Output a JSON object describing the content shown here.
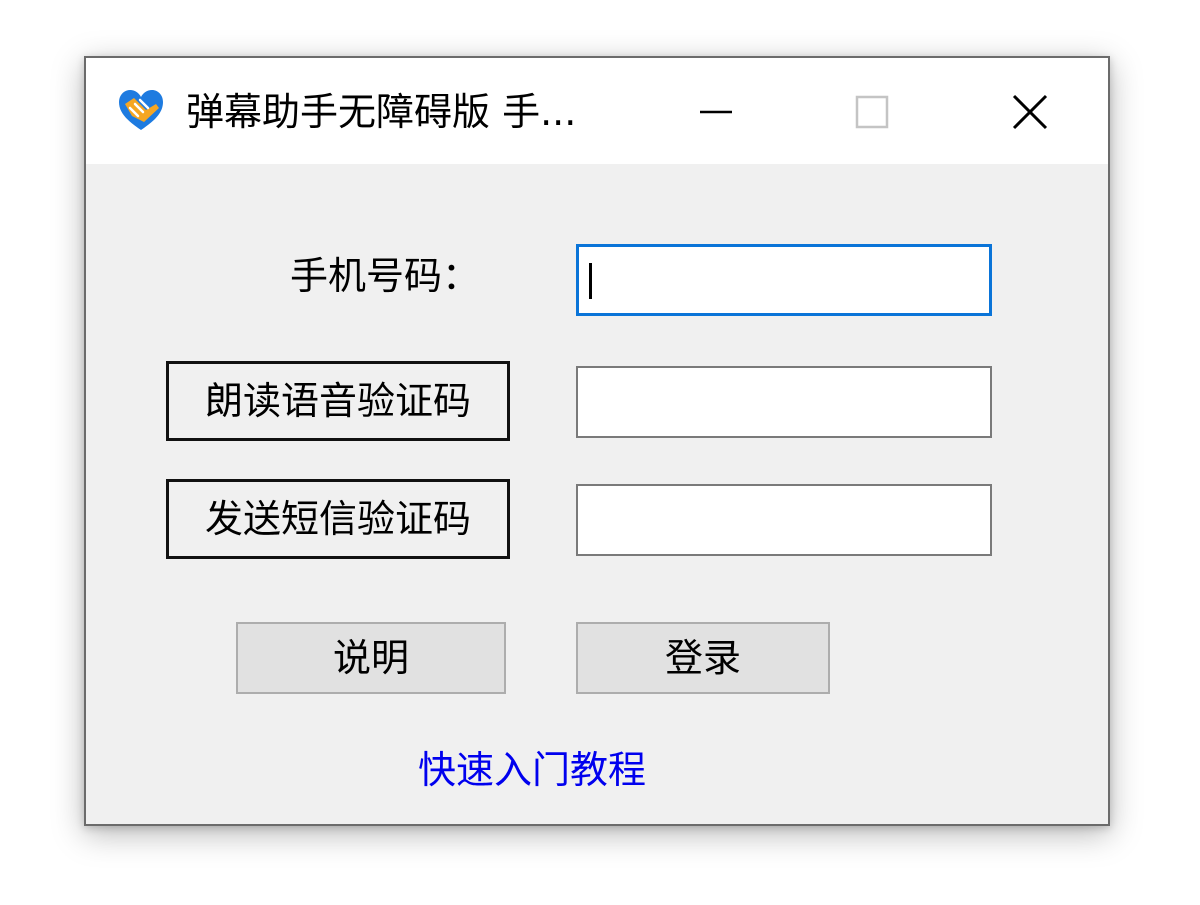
{
  "window": {
    "title": "弹幕助手无障碍版 手...",
    "app_icon": "heart-hand-icon",
    "controls": {
      "minimize_icon": "minimize-icon",
      "maximize_icon": "maximize-icon",
      "close_icon": "close-icon"
    }
  },
  "form": {
    "phone_label": "手机号码：",
    "phone_value": "",
    "voice_code_button": "朗读语音验证码",
    "voice_code_value": "",
    "sms_code_button": "发送短信验证码",
    "sms_code_value": ""
  },
  "actions": {
    "help_label": "说明",
    "login_label": "登录"
  },
  "link": {
    "quickstart": "快速入门教程"
  },
  "colors": {
    "focus_border": "#0a74d8",
    "link": "#0000ee",
    "icon_blue": "#1e7be0",
    "icon_orange": "#f5a623"
  }
}
